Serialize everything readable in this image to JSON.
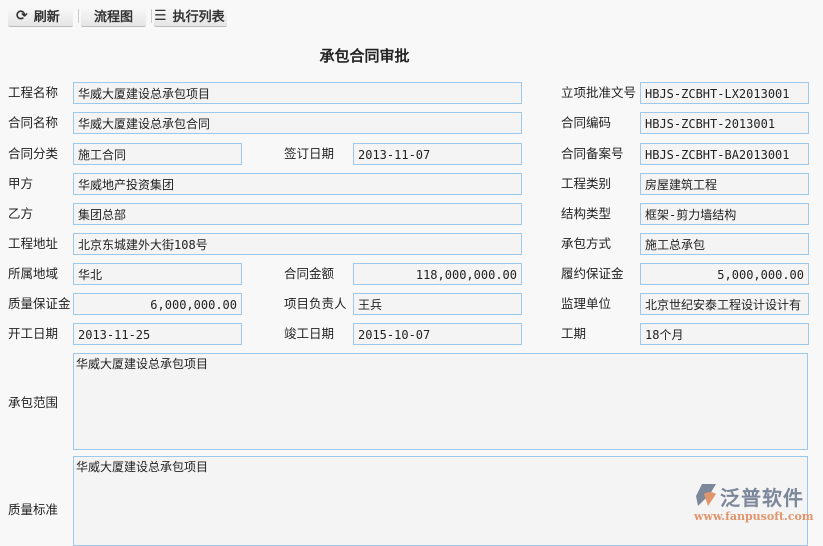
{
  "toolbar": {
    "refresh": "刷新",
    "flow": "流程图",
    "exec_list": "执行列表"
  },
  "title": "承包合同审批",
  "fields": {
    "project_name": {
      "label": "工程名称",
      "value": "华威大厦建设总承包项目"
    },
    "approval_no": {
      "label": "立项批准文号",
      "value": "HBJS-ZCBHT-LX2013001"
    },
    "contract_name": {
      "label": "合同名称",
      "value": "华威大厦建设总承包合同"
    },
    "contract_code": {
      "label": "合同编码",
      "value": "HBJS-ZCBHT-2013001"
    },
    "contract_type": {
      "label": "合同分类",
      "value": "施工合同"
    },
    "sign_date": {
      "label": "签订日期",
      "value": "2013-11-07"
    },
    "record_no": {
      "label": "合同备案号",
      "value": "HBJS-ZCBHT-BA2013001"
    },
    "party_a": {
      "label": "甲方",
      "value": "华威地产投资集团"
    },
    "project_type": {
      "label": "工程类别",
      "value": "房屋建筑工程"
    },
    "party_b": {
      "label": "乙方",
      "value": "集团总部"
    },
    "structure": {
      "label": "结构类型",
      "value": "框架-剪力墙结构"
    },
    "address": {
      "label": "工程地址",
      "value": "北京东城建外大街108号"
    },
    "contract_mode": {
      "label": "承包方式",
      "value": "施工总承包"
    },
    "region": {
      "label": "所属地域",
      "value": "华北"
    },
    "amount": {
      "label": "合同金额",
      "value": "118,000,000.00"
    },
    "performance_bond": {
      "label": "履约保证金",
      "value": "5,000,000.00"
    },
    "quality_bond": {
      "label": "质量保证金",
      "value": "6,000,000.00"
    },
    "manager": {
      "label": "项目负责人",
      "value": "王兵"
    },
    "supervisor": {
      "label": "监理单位",
      "value": "北京世纪安泰工程设计设计有"
    },
    "start_date": {
      "label": "开工日期",
      "value": "2013-11-25"
    },
    "end_date": {
      "label": "竣工日期",
      "value": "2015-10-07"
    },
    "duration": {
      "label": "工期",
      "value": "18个月"
    },
    "scope": {
      "label": "承包范围",
      "value": "华威大厦建设总承包项目"
    },
    "quality": {
      "label": "质量标准",
      "value": "华威大厦建设总承包项目"
    }
  },
  "logo": {
    "name": "泛普软件",
    "url": "www.fanpusoft.com"
  }
}
